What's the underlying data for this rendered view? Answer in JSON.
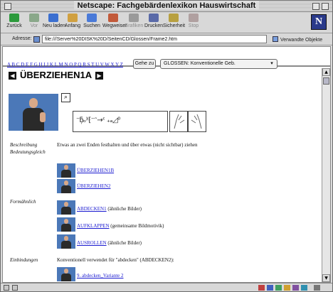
{
  "window": {
    "title": "Netscape: Fachgebärdenlexikon Hauswirtschaft"
  },
  "toolbar": {
    "buttons": [
      {
        "label": "Zurück",
        "icon": "back-arrow-icon",
        "color": "#2c9a3c",
        "enabled": true
      },
      {
        "label": "Vor",
        "icon": "forward-arrow-icon",
        "color": "#8aa88a",
        "enabled": false
      },
      {
        "label": "Neu laden",
        "icon": "reload-icon",
        "color": "#3b6fd0",
        "enabled": true
      },
      {
        "label": "Anfang",
        "icon": "home-icon",
        "color": "#d0a040",
        "enabled": true
      },
      {
        "label": "Suchen",
        "icon": "search-icon",
        "color": "#4a7ad8",
        "enabled": true
      },
      {
        "label": "Wegweiser",
        "icon": "guide-icon",
        "color": "#c25a3a",
        "enabled": true
      },
      {
        "label": "Grafiken",
        "icon": "images-icon",
        "color": "#9a9a9a",
        "enabled": false
      },
      {
        "label": "Drucken",
        "icon": "print-icon",
        "color": "#5a6aa8",
        "enabled": true
      },
      {
        "label": "Sicherheit",
        "icon": "lock-icon",
        "color": "#b8a040",
        "enabled": true
      },
      {
        "label": "Stop",
        "icon": "stop-icon",
        "color": "#b0a0a0",
        "enabled": false
      }
    ]
  },
  "location": {
    "label": "Adresse:",
    "url": "file:///Server%20DISK%20D/SeitenCD/Glossen/Frame2.htm",
    "related_label": "Verwandte Objekte"
  },
  "topnav": {
    "alphabet": "A B C D E F G H I J K L M N O P Q R S T U V W X Y Z",
    "go_button": "Gehe zu",
    "select_value": "GLOSSEN: Konventionelle Geb."
  },
  "entry": {
    "headword": "ÜBERZIEHEN1A",
    "notation": "⁻ƃ᷊ₒ⁾⁽⁅⁻ᵔ→ᵋ ₊ₐ◿⁰",
    "description_label": "Beschreibung",
    "description_text": "Etwas an zwei Enden festhalten und über etwas (nicht sichtbar) ziehen",
    "variants_label": "Bedeutungsgleich",
    "variants": [
      "ÜBERZIEHEN1B",
      "ÜBERZIEHEN2"
    ],
    "similar_label": "Formähnlich",
    "similar": [
      {
        "link": "ABDECKEN1",
        "note": "(ähnliche Bilder)"
      },
      {
        "link": "AUFKLAPPEN",
        "note": "(gemeinsame Bildmotivik)"
      },
      {
        "link": "AUSROLLEN",
        "note": "(ähnliche Bilder)"
      }
    ],
    "usage_label": "Einbindungen",
    "usage_text": "Konventionell verwendet für \"abdecken\" (ABDECKEN2):",
    "usage_link": "9. abdecken_Variante 2"
  }
}
